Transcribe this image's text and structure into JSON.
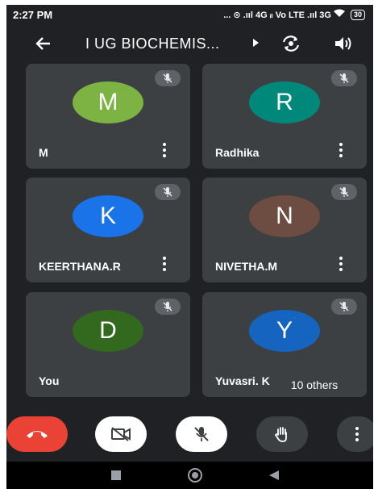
{
  "status": {
    "time": "2:27 PM",
    "network": "... ⊙ .ııl 4G ᵢₗ Vo LTE .ııl 3G",
    "battery": "30"
  },
  "header": {
    "title": "I UG BIOCHEMIS..."
  },
  "participants": [
    {
      "initial": "M",
      "name": "M",
      "color": "#7cb342"
    },
    {
      "initial": "R",
      "name": "Radhika",
      "color": "#00897b"
    },
    {
      "initial": "K",
      "name": "KEERTHANA.R",
      "color": "#1a73e8"
    },
    {
      "initial": "N",
      "name": "NIVETHA.M",
      "color": "#6d4c41"
    },
    {
      "initial": "D",
      "name": "You",
      "color": "#33691e"
    },
    {
      "initial": "Y",
      "name": "Yuvasri. K",
      "color": "#1565c0"
    }
  ],
  "others_label": "10 others",
  "controls": {
    "end_call_color": "#ea4335",
    "button_light": "#ffffff",
    "button_dark": "#3c4043"
  }
}
